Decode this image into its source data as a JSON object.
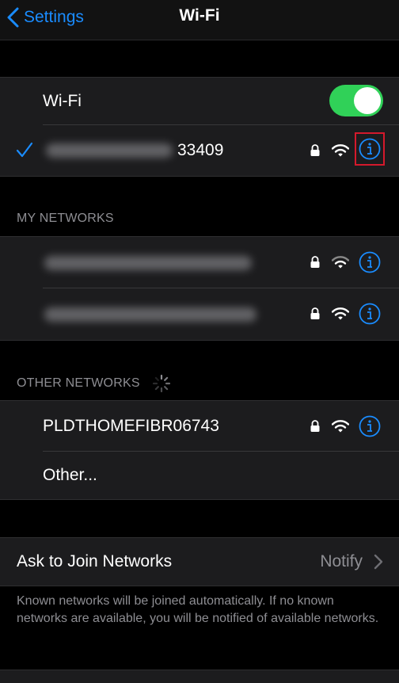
{
  "navbar": {
    "back_label": "Settings",
    "title": "Wi-Fi"
  },
  "wifi_toggle": {
    "label": "Wi-Fi",
    "state": "on"
  },
  "connected_network": {
    "name_visible_suffix": "33409",
    "secured": true
  },
  "my_networks": {
    "header": "MY NETWORKS"
  },
  "other_networks": {
    "header": "OTHER NETWORKS",
    "items": [
      {
        "name": "PLDTHOMEFIBR06743",
        "secured": true
      }
    ],
    "other_label": "Other..."
  },
  "ask_to_join": {
    "label": "Ask to Join Networks",
    "value": "Notify"
  },
  "footer_text": "Known networks will be joined automatically. If no known networks are available, you will be notified of available networks.",
  "colors": {
    "accent": "#1a8cff",
    "toggle_on": "#30d158",
    "highlight": "#d4192c",
    "background": "#000000",
    "cell": "#1c1c1e",
    "secondary_text": "#8e8e93"
  }
}
